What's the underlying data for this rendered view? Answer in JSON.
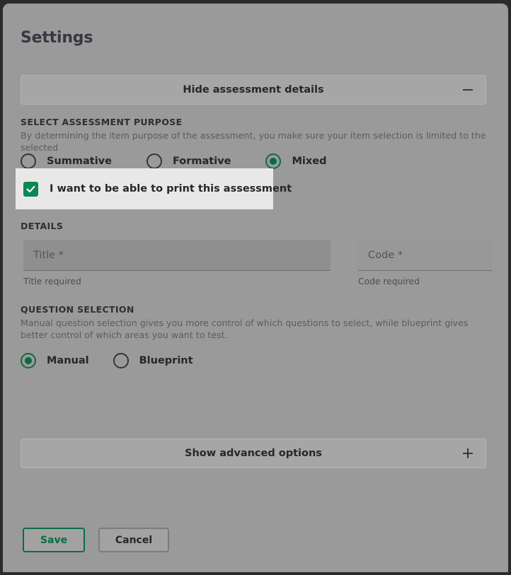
{
  "dialog": {
    "title": "Settings"
  },
  "sections": {
    "hide_details": {
      "label": "Hide assessment details",
      "toggle_icon": "minus-icon"
    },
    "show_advanced": {
      "label": "Show advanced options",
      "toggle_icon": "plus-icon"
    }
  },
  "purpose": {
    "label": "SELECT ASSESSMENT PURPOSE",
    "description": "By determining the item purpose of the assessment, you make sure your item selection is limited to the selected",
    "options": [
      {
        "label": "Summative",
        "selected": false
      },
      {
        "label": "Formative",
        "selected": false
      },
      {
        "label": "Mixed",
        "selected": true
      }
    ]
  },
  "print_option": {
    "label": "I want to be able to print this assessment",
    "checked": true,
    "check_icon": "checkmark-icon",
    "highlight_color": "#e8e8e8"
  },
  "details": {
    "label": "DETAILS",
    "title_field": {
      "value": "",
      "placeholder": "Title *",
      "hint": "Title required"
    },
    "code_field": {
      "value": "",
      "placeholder": "Code *",
      "hint": "Code required"
    }
  },
  "question_selection": {
    "label": "QUESTION SELECTION",
    "description": "Manual question selection gives you more control of which questions to select, while blueprint gives better control of which areas you want to test.",
    "options": [
      {
        "label": "Manual",
        "selected": true
      },
      {
        "label": "Blueprint",
        "selected": false
      }
    ]
  },
  "footer": {
    "save_label": "Save",
    "cancel_label": "Cancel"
  },
  "colors": {
    "accent_green": "#0a6b43",
    "checkbox_green": "#0a8754",
    "surface": "#9a9a9a"
  }
}
